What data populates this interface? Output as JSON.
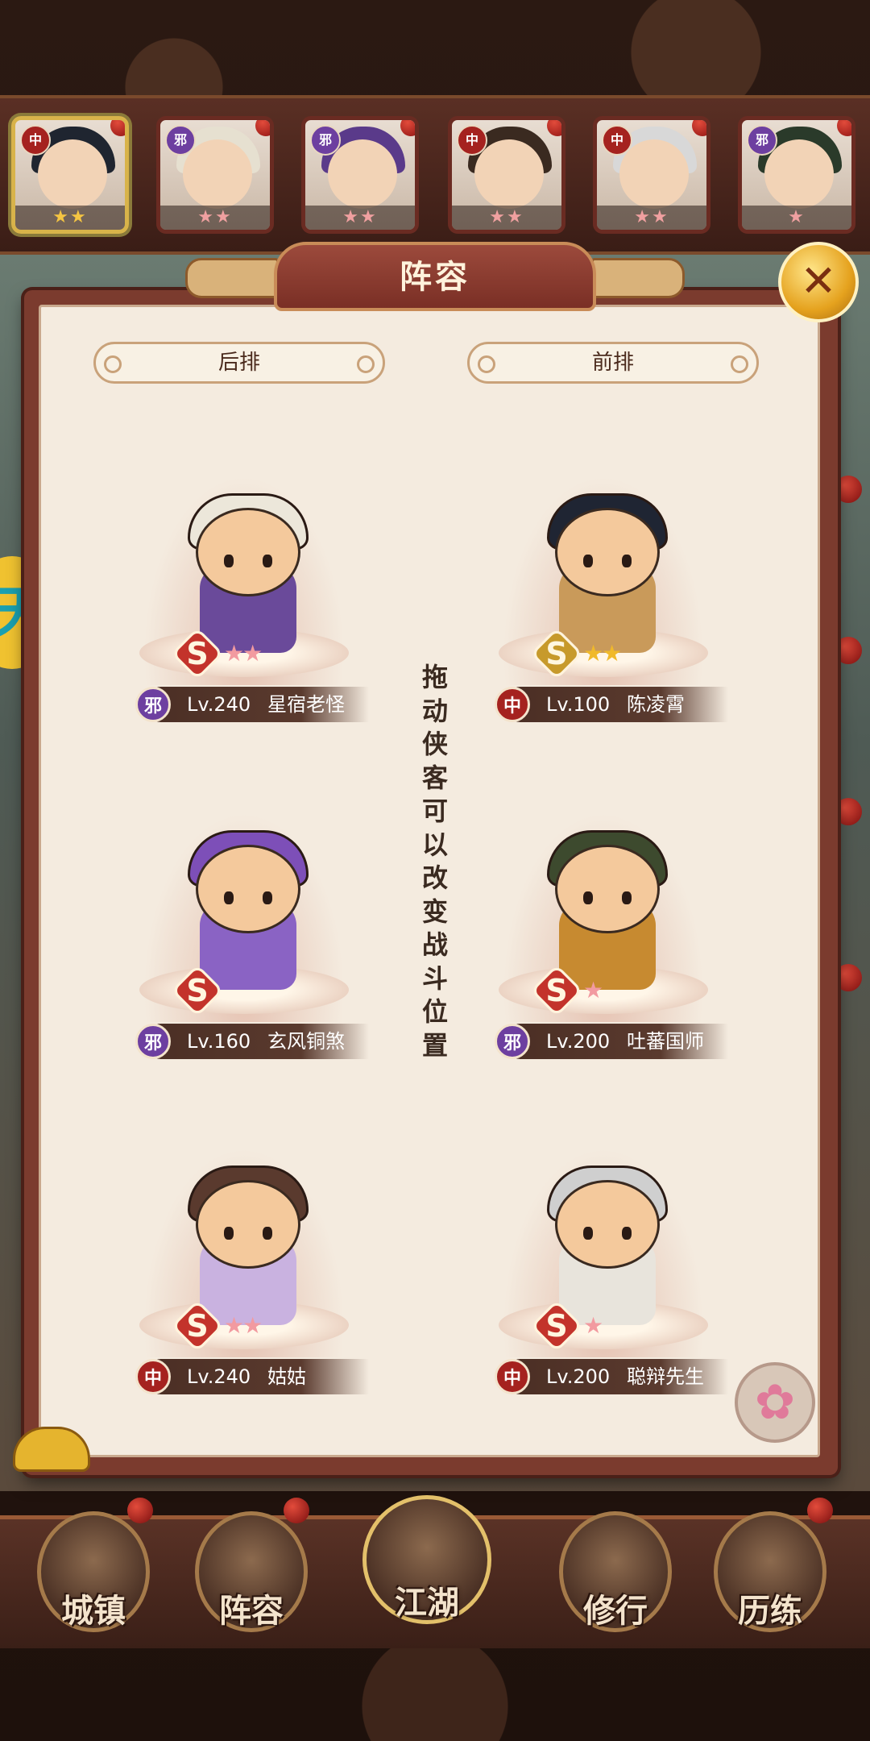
{
  "panel": {
    "title": "阵容",
    "close_icon_glyph": "✕",
    "back_row_label": "后排",
    "front_row_label": "前排",
    "hint": "拖动侠客可以改变战斗位置"
  },
  "roster": [
    {
      "faction": "中",
      "stars": "★★",
      "star_color": "gold",
      "selected": true,
      "hair": "#1f2530"
    },
    {
      "faction": "邪",
      "stars": "★★",
      "star_color": "pink",
      "selected": false,
      "hair": "#e6e0d0"
    },
    {
      "faction": "邪",
      "stars": "★★",
      "star_color": "pink",
      "selected": false,
      "hair": "#5a3a8a"
    },
    {
      "faction": "中",
      "stars": "★★",
      "star_color": "pink",
      "selected": false,
      "hair": "#3a2a20"
    },
    {
      "faction": "中",
      "stars": "★★",
      "star_color": "pink",
      "selected": false,
      "hair": "#d8d8d8"
    },
    {
      "faction": "邪",
      "stars": "★",
      "star_color": "pink",
      "selected": false,
      "hair": "#2a3a2a"
    }
  ],
  "formation": {
    "back": [
      {
        "faction": "邪",
        "level": "Lv.240",
        "name": "星宿老怪",
        "grade": "S",
        "grade_color": "red",
        "stars": "★★",
        "star_color": "pink",
        "hair": "#ece7da",
        "robe": "#6a4a9a"
      },
      {
        "faction": "邪",
        "level": "Lv.160",
        "name": "玄风铜煞",
        "grade": "S",
        "grade_color": "red",
        "stars": "",
        "star_color": "pink",
        "hair": "#7d4fb8",
        "robe": "#8a63c4"
      },
      {
        "faction": "中",
        "level": "Lv.240",
        "name": "姑姑",
        "grade": "S",
        "grade_color": "red",
        "stars": "★★",
        "star_color": "pink",
        "hair": "#5a3a2e",
        "robe": "#c9b2e0"
      }
    ],
    "front": [
      {
        "faction": "中",
        "level": "Lv.100",
        "name": "陈凌霄",
        "grade": "S",
        "grade_color": "gold",
        "stars": "★★",
        "star_color": "gold",
        "hair": "#1f2533",
        "robe": "#c99a5a"
      },
      {
        "faction": "邪",
        "level": "Lv.200",
        "name": "吐蕃国师",
        "grade": "S",
        "grade_color": "red",
        "stars": "★",
        "star_color": "pink",
        "hair": "#3d4a2e",
        "robe": "#c78a30"
      },
      {
        "faction": "中",
        "level": "Lv.200",
        "name": "聪辩先生",
        "grade": "S",
        "grade_color": "red",
        "stars": "★",
        "star_color": "pink",
        "hair": "#cfcfcf",
        "robe": "#e8e4dc"
      }
    ]
  },
  "bottom_nav": [
    "城镇",
    "阵容",
    "江湖",
    "修行",
    "历练"
  ],
  "side_deco_text": "天",
  "lotus_icon_glyph": "✿"
}
